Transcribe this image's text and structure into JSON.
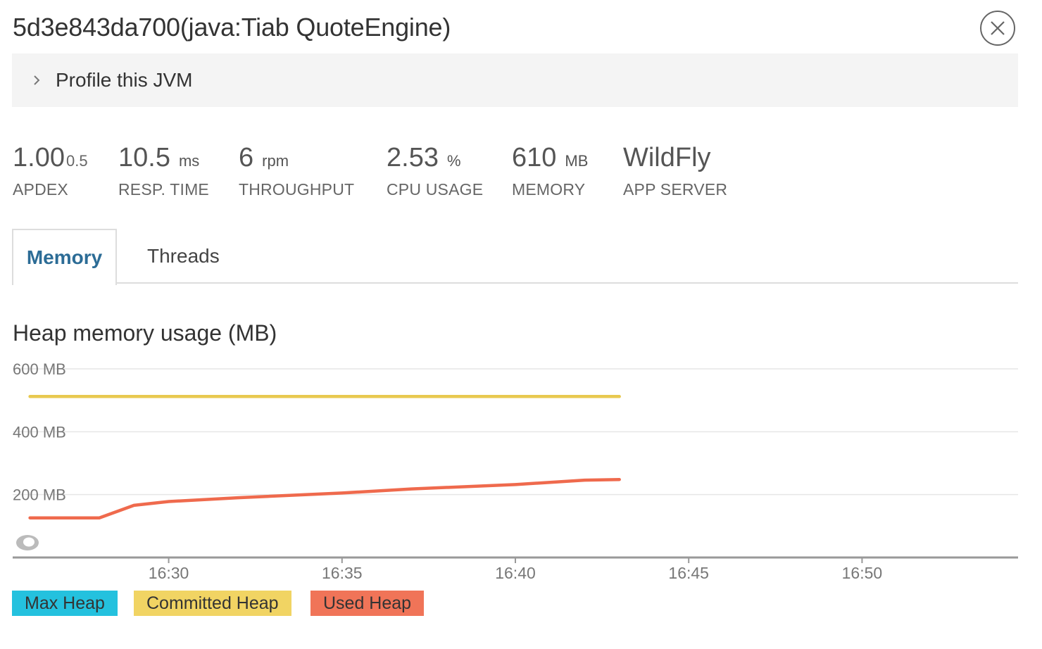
{
  "header": {
    "title": "5d3e843da700(java:Tiab QuoteEngine)",
    "close_icon": "close-icon"
  },
  "profile": {
    "label": "Profile this JVM",
    "icon": "chevron-right-icon"
  },
  "metrics": {
    "apdex": {
      "value": "1.00",
      "sub": "0.5",
      "caption": "APDEX"
    },
    "resp_time": {
      "value": "10.5",
      "unit": "ms",
      "caption": "RESP. TIME"
    },
    "throughput": {
      "value": "6",
      "unit": "rpm",
      "caption": "THROUGHPUT"
    },
    "cpu": {
      "value": "2.53",
      "unit": "%",
      "caption": "CPU USAGE"
    },
    "memory": {
      "value": "610",
      "unit": "MB",
      "caption": "MEMORY"
    },
    "app_server": {
      "value": "WildFly",
      "caption": "APP SERVER"
    }
  },
  "tabs": [
    {
      "label": "Memory",
      "active": true
    },
    {
      "label": "Threads",
      "active": false
    }
  ],
  "colors": {
    "max_heap": "#24c1de",
    "committed_heap": "#f1d463",
    "used_heap": "#f07458",
    "committed_line": "#e8c94f",
    "used_line": "#ef6a4d",
    "active_tab": "#2c6c96"
  },
  "chart_data": {
    "type": "line",
    "title": "Heap memory usage (MB)",
    "ylim": [
      0,
      600
    ],
    "y_ticks": [
      {
        "value": 600,
        "label": "600 MB"
      },
      {
        "value": 400,
        "label": "400 MB"
      },
      {
        "value": 200,
        "label": "200 MB"
      }
    ],
    "x_range": [
      "16:25:30",
      "16:54:30"
    ],
    "x_ticks": [
      "16:30",
      "16:35",
      "16:40",
      "16:45",
      "16:50"
    ],
    "grid": true,
    "legend_position": "bottom-left",
    "legend": [
      "Max Heap",
      "Committed Heap",
      "Used Heap"
    ],
    "series": [
      {
        "name": "Committed Heap",
        "points": [
          {
            "x": "16:26",
            "y": 512
          },
          {
            "x": "16:43",
            "y": 512
          }
        ]
      },
      {
        "name": "Used Heap",
        "points": [
          {
            "x": "16:26",
            "y": 126
          },
          {
            "x": "16:28",
            "y": 126
          },
          {
            "x": "16:29",
            "y": 166
          },
          {
            "x": "16:30",
            "y": 178
          },
          {
            "x": "16:32",
            "y": 190
          },
          {
            "x": "16:35",
            "y": 205
          },
          {
            "x": "16:37",
            "y": 218
          },
          {
            "x": "16:40",
            "y": 232
          },
          {
            "x": "16:42",
            "y": 246
          },
          {
            "x": "16:43",
            "y": 248
          }
        ]
      }
    ]
  }
}
